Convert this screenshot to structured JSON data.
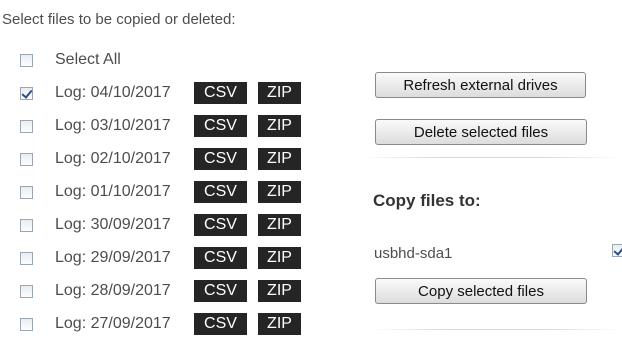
{
  "header": {
    "text": "Select files to be copied or deleted:"
  },
  "select_all": {
    "label": "Select All",
    "checked": false
  },
  "logs": [
    {
      "label": "Log: 04/10/2017",
      "checked": true,
      "csv": "CSV",
      "zip": "ZIP"
    },
    {
      "label": "Log: 03/10/2017",
      "checked": false,
      "csv": "CSV",
      "zip": "ZIP"
    },
    {
      "label": "Log: 02/10/2017",
      "checked": false,
      "csv": "CSV",
      "zip": "ZIP"
    },
    {
      "label": "Log: 01/10/2017",
      "checked": false,
      "csv": "CSV",
      "zip": "ZIP"
    },
    {
      "label": "Log: 30/09/2017",
      "checked": false,
      "csv": "CSV",
      "zip": "ZIP"
    },
    {
      "label": "Log: 29/09/2017",
      "checked": false,
      "csv": "CSV",
      "zip": "ZIP"
    },
    {
      "label": "Log: 28/09/2017",
      "checked": false,
      "csv": "CSV",
      "zip": "ZIP"
    },
    {
      "label": "Log: 27/09/2017",
      "checked": false,
      "csv": "CSV",
      "zip": "ZIP"
    }
  ],
  "buttons": {
    "refresh": "Refresh external drives",
    "delete": "Delete selected files",
    "copy": "Copy selected files"
  },
  "copy_section": {
    "heading": "Copy files to:",
    "drive": {
      "label": "usbhd-sda1",
      "checked": true
    }
  },
  "colors": {
    "tag_background": "#252525",
    "tag_text": "#ffffff",
    "check_mark": "#2b4c8c"
  }
}
